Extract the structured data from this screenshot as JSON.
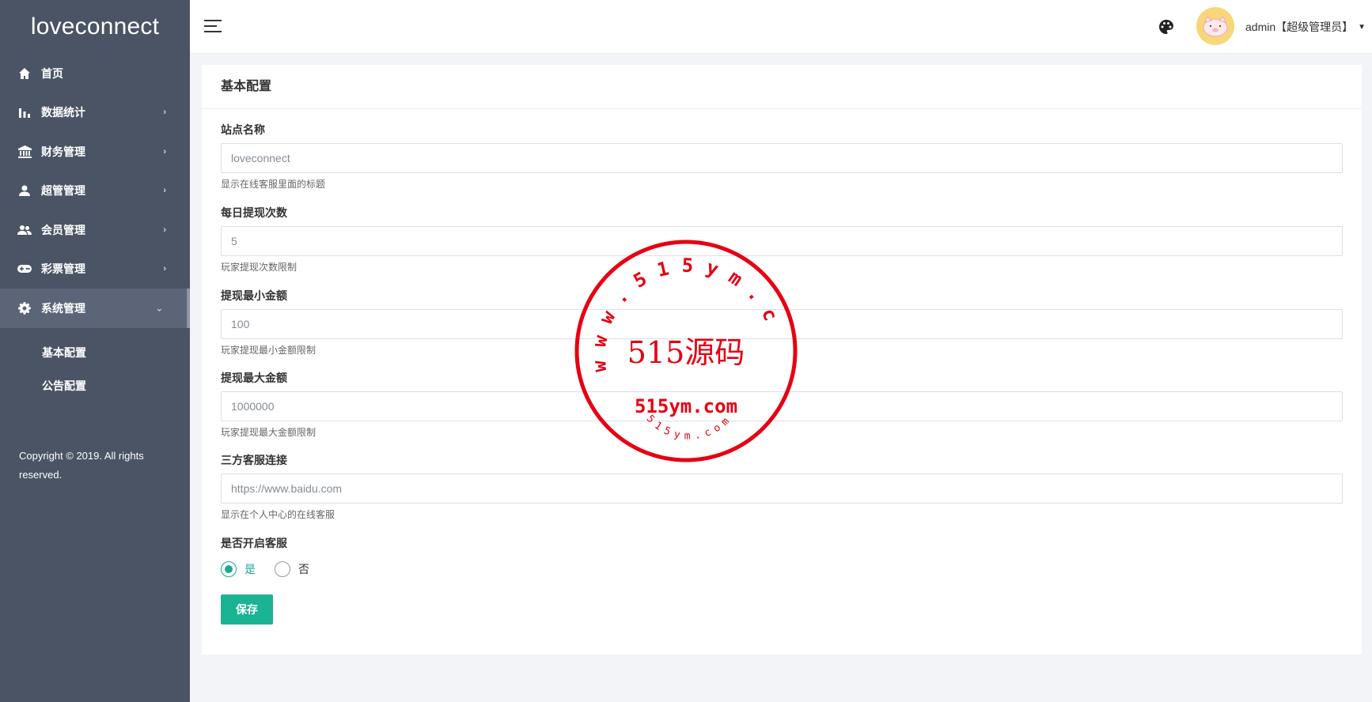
{
  "brand": "loveconnect",
  "sidebar": {
    "items": [
      {
        "label": "首页",
        "icon": "home-icon"
      },
      {
        "label": "数据统计",
        "icon": "bar-chart-icon"
      },
      {
        "label": "财务管理",
        "icon": "bank-icon"
      },
      {
        "label": "超管管理",
        "icon": "person-icon"
      },
      {
        "label": "会员管理",
        "icon": "people-icon"
      },
      {
        "label": "彩票管理",
        "icon": "gamepad-icon"
      },
      {
        "label": "系统管理",
        "icon": "gear-icon"
      }
    ],
    "submenu": [
      "基本配置",
      "公告配置"
    ],
    "copyright": "Copyright © 2019. All rights reserved."
  },
  "header": {
    "user": "admin【超级管理员】"
  },
  "card": {
    "title": "基本配置"
  },
  "form": {
    "site_name": {
      "label": "站点名称",
      "value": "loveconnect",
      "help": "显示在线客服里面的标题"
    },
    "daily_withdraw": {
      "label": "每日提现次数",
      "value": "5",
      "help": "玩家提现次数限制"
    },
    "min_withdraw": {
      "label": "提现最小金额",
      "value": "100",
      "help": "玩家提现最小金额限制"
    },
    "max_withdraw": {
      "label": "提现最大金额",
      "value": "1000000",
      "help": "玩家提现最大金额限制"
    },
    "service_url": {
      "label": "三方客服连接",
      "value": "https://www.baidu.com",
      "help": "显示在个人中心的在线客服"
    },
    "service_enabled": {
      "label": "是否开启客服",
      "options": [
        "是",
        "否"
      ],
      "selected": "是"
    },
    "save_label": "保存"
  },
  "watermark": {
    "center": "515源码",
    "url": "515ym.com",
    "ring_top": "www.515ym.com",
    "ring_bottom": "515ym.com"
  },
  "colors": {
    "sidebar": "#4a5465",
    "accent": "#1ab393",
    "stamp": "#e60012"
  }
}
